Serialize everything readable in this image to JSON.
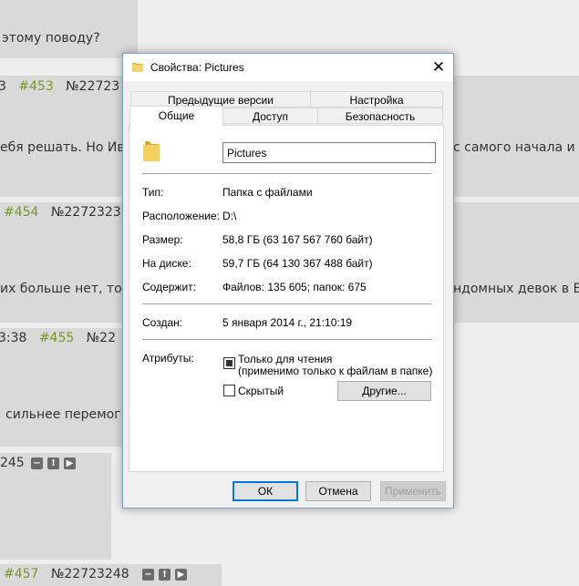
{
  "background": {
    "texts": [
      "этому поводу?",
      "ебя решать. Но Ив",
      "с самого начала и",
      "их больше нет, то",
      "ндомных девок в В",
      "сильнее перемог"
    ],
    "meta": [
      {
        "prefix": "3",
        "num": "#453",
        "id": "№22723"
      },
      {
        "prefix": "",
        "num": "#454",
        "id": "№2272323"
      },
      {
        "prefix": "3:38",
        "num": "#455",
        "id": "№22"
      },
      {
        "prefix": "245",
        "num": "",
        "id": ""
      },
      {
        "prefix": "",
        "num": "#457",
        "id": "№22723248"
      }
    ],
    "btn_glyphs": [
      "−",
      "!",
      "▶"
    ]
  },
  "dialog": {
    "title": "Свойства: Pictures",
    "close_glyph": "✕",
    "tabs_row1": [
      "Предыдущие версии",
      "Настройка"
    ],
    "tabs_row2": [
      "Общие",
      "Доступ",
      "Безопасность"
    ],
    "active_tab": "Общие",
    "folder_name": "Pictures",
    "props": [
      {
        "label": "Тип:",
        "value": "Папка с файлами"
      },
      {
        "label": "Расположение:",
        "value": "D:\\"
      },
      {
        "label": "Размер:",
        "value": "58,8 ГБ (63 167 567 760 байт)"
      },
      {
        "label": "На диске:",
        "value": "59,7 ГБ (64 130 367 488 байт)"
      },
      {
        "label": "Содержит:",
        "value": "Файлов: 135 605; папок: 675"
      }
    ],
    "created_label": "Создан:",
    "created_value": "5 января 2014 г., 21:10:19",
    "attributes_label": "Атрибуты:",
    "readonly_label": "Только для чтения",
    "readonly_note": "(применимо только к файлам в папке)",
    "hidden_label": "Скрытый",
    "other_button": "Другие...",
    "ok_button": "ОК",
    "cancel_button": "Отмена",
    "apply_button": "Применить"
  },
  "colors": {
    "accent": "#0078d7",
    "folder": "#e8b93a",
    "link_green": "#789922"
  }
}
